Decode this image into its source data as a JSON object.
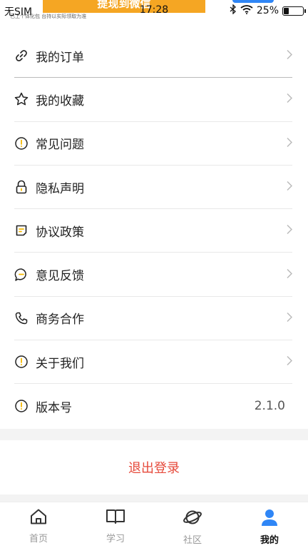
{
  "status_bar": {
    "carrier": "无SIM",
    "time": "17:28",
    "battery": "25%",
    "battery_level": 0.25
  },
  "banner": {
    "title": "提现到微信",
    "subtitle": "已上个体化包  台持以实际领取为准"
  },
  "menu": {
    "items": [
      {
        "label": "我的订单",
        "icon": "link-icon"
      },
      {
        "label": "我的收藏",
        "icon": "star-icon"
      },
      {
        "label": "常见问题",
        "icon": "question-icon"
      },
      {
        "label": "隐私声明",
        "icon": "lock-icon"
      },
      {
        "label": "协议政策",
        "icon": "document-icon"
      },
      {
        "label": "意见反馈",
        "icon": "chat-icon"
      },
      {
        "label": "商务合作",
        "icon": "phone-icon"
      },
      {
        "label": "关于我们",
        "icon": "info-icon"
      }
    ],
    "version": {
      "label": "版本号",
      "value": "2.1.0",
      "icon": "info-icon"
    }
  },
  "logout_label": "退出登录",
  "tabs": [
    {
      "label": "首页",
      "icon": "home-icon"
    },
    {
      "label": "学习",
      "icon": "book-icon"
    },
    {
      "label": "社区",
      "icon": "planet-icon"
    },
    {
      "label": "我的",
      "icon": "user-icon",
      "active": true
    }
  ],
  "colors": {
    "accent": "#2f86f6",
    "logout": "#e64a3b",
    "banner": "#f5a623",
    "icon_yellow": "#f5b800"
  }
}
